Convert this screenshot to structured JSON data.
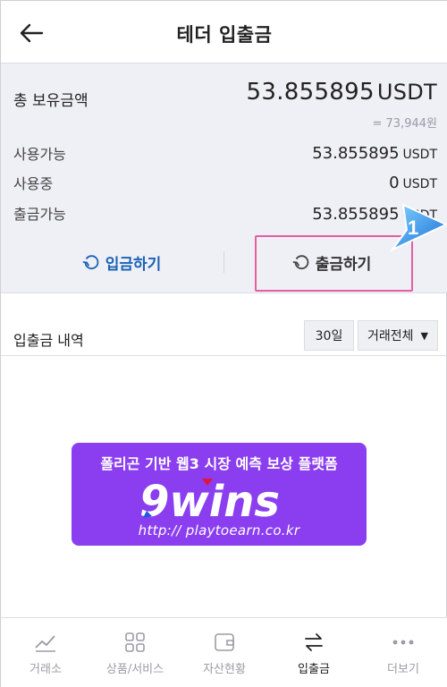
{
  "header": {
    "title": "테더 입출금",
    "back_icon": "arrow-left-icon"
  },
  "summary": {
    "total_label": "총 보유금액",
    "total_amount": "53.855895",
    "total_unit": "USDT",
    "krw_equivalent": "= 73,944원",
    "rows": [
      {
        "label": "사용가능",
        "amount": "53.855895",
        "unit": "USDT"
      },
      {
        "label": "사용중",
        "amount": "0",
        "unit": "USDT"
      },
      {
        "label": "출금가능",
        "amount": "53.855895",
        "unit": "USDT"
      }
    ]
  },
  "actions": {
    "deposit_label": "입금하기",
    "withdraw_label": "출금하기",
    "deposit_color": "#1a62b6",
    "highlight_color": "#e25fa4"
  },
  "annotation": {
    "step_number": "1"
  },
  "history": {
    "title": "입출금 내역",
    "period": "30일",
    "type_filter": "거래전체"
  },
  "banner": {
    "headline": "폴리곤 기반 웹3 시장 예측 보상 플랫폼",
    "logo_text": "9wins",
    "url": "http:// playtoearn.co.kr",
    "background": "#8a3ef0"
  },
  "tabbar": {
    "items": [
      {
        "label": "거래소",
        "icon": "chart-line-icon"
      },
      {
        "label": "상품/서비스",
        "icon": "grid-icon"
      },
      {
        "label": "자산현황",
        "icon": "wallet-icon"
      },
      {
        "label": "입출금",
        "icon": "transfer-arrows-icon",
        "active": true
      },
      {
        "label": "더보기",
        "icon": "more-dots-icon"
      }
    ]
  }
}
